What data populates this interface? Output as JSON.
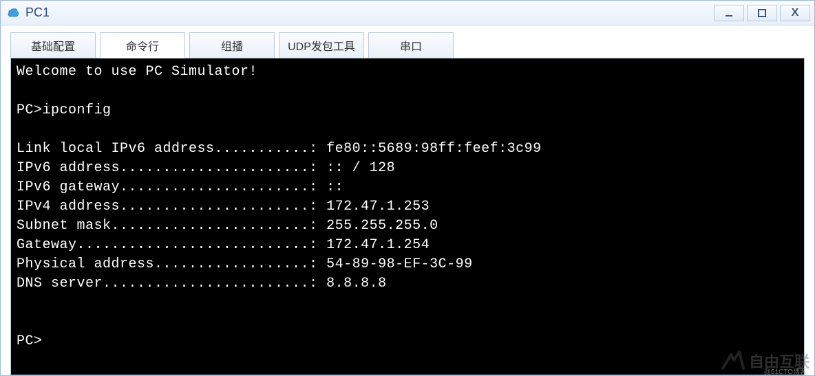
{
  "window": {
    "title": "PC1"
  },
  "tabs": [
    {
      "label": "基础配置",
      "active": false
    },
    {
      "label": "命令行",
      "active": true
    },
    {
      "label": "组播",
      "active": false
    },
    {
      "label": "UDP发包工具",
      "active": false
    },
    {
      "label": "串口",
      "active": false
    }
  ],
  "terminal": {
    "welcome": "Welcome to use PC Simulator!",
    "prompt1": "PC>ipconfig",
    "lines": {
      "linklocal_label": "Link local IPv6 address...........: ",
      "linklocal_value": "fe80::5689:98ff:feef:3c99",
      "ipv6addr_label": "IPv6 address......................: ",
      "ipv6addr_value": ":: / 128",
      "ipv6gw_label": "IPv6 gateway......................: ",
      "ipv6gw_value": "::",
      "ipv4addr_label": "IPv4 address......................: ",
      "ipv4addr_value": "172.47.1.253",
      "subnet_label": "Subnet mask.......................: ",
      "subnet_value": "255.255.255.0",
      "gateway_label": "Gateway...........................: ",
      "gateway_value": "172.47.1.254",
      "mac_label": "Physical address..................: ",
      "mac_value": "54-89-98-EF-3C-99",
      "dns_label": "DNS server........................: ",
      "dns_value": "8.8.8.8"
    },
    "prompt2": "PC>"
  },
  "watermark": {
    "text": "自由互联",
    "sub": "@51CTO博客"
  }
}
